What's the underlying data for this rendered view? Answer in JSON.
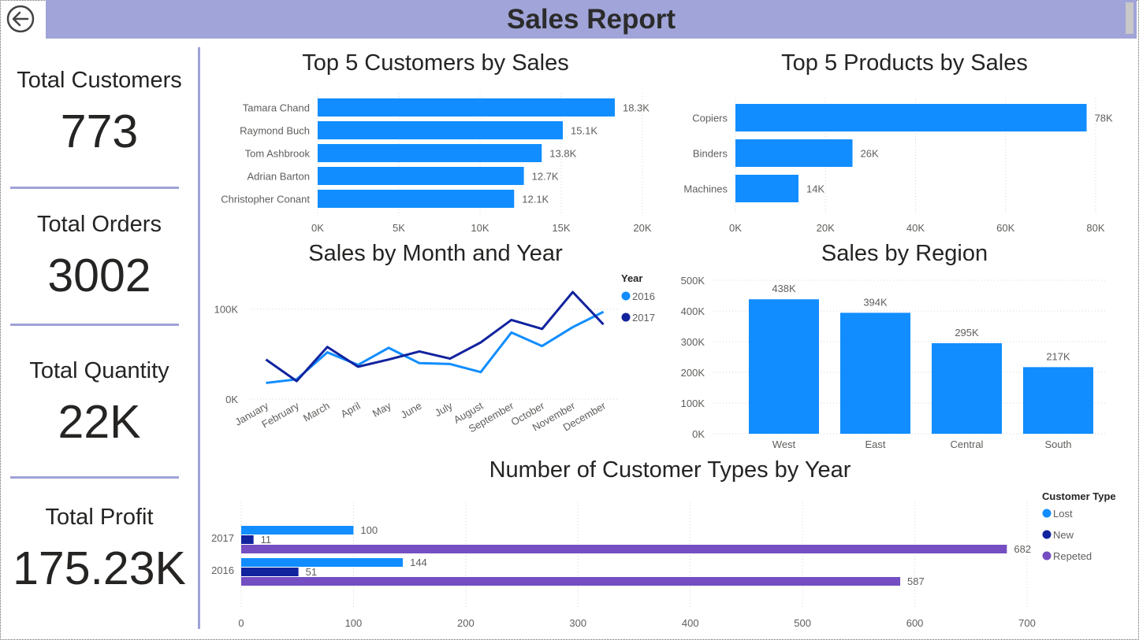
{
  "header": {
    "title": "Sales Report"
  },
  "kpis": [
    {
      "label": "Total Customers",
      "value": "773"
    },
    {
      "label": "Total Orders",
      "value": "3002"
    },
    {
      "label": "Total Quantity",
      "value": "22K"
    },
    {
      "label": "Total Profit",
      "value": "175.23K"
    }
  ],
  "colors": {
    "accent": "#118dff",
    "dark": "#12239e",
    "purple": "#744ec2",
    "header_bg": "#a0a4d8",
    "divider": "#9fa2d6"
  },
  "icons": {
    "back": "back-arrow-circle-icon"
  },
  "chart_data": [
    {
      "id": "customers",
      "type": "bar",
      "orientation": "horizontal",
      "title": "Top 5 Customers by Sales",
      "categories": [
        "Tamara Chand",
        "Raymond Buch",
        "Tom Ashbrook",
        "Adrian Barton",
        "Christopher Conant"
      ],
      "values": [
        18300,
        15100,
        13800,
        12700,
        12100
      ],
      "data_labels": [
        "18.3K",
        "15.1K",
        "13.8K",
        "12.7K",
        "12.1K"
      ],
      "xlim": [
        0,
        20000
      ],
      "ticks": [
        0,
        5000,
        10000,
        15000,
        20000
      ],
      "tick_labels": [
        "0K",
        "5K",
        "10K",
        "15K",
        "20K"
      ],
      "grid": true
    },
    {
      "id": "products",
      "type": "bar",
      "orientation": "horizontal",
      "title": "Top 5 Products by Sales",
      "categories": [
        "Copiers",
        "Binders",
        "Machines"
      ],
      "values": [
        78000,
        26000,
        14000
      ],
      "data_labels": [
        "78K",
        "26K",
        "14K"
      ],
      "xlim": [
        0,
        80000
      ],
      "ticks": [
        0,
        20000,
        40000,
        60000,
        80000
      ],
      "tick_labels": [
        "0K",
        "20K",
        "40K",
        "60K",
        "80K"
      ],
      "grid": true
    },
    {
      "id": "monthly",
      "type": "line",
      "title": "Sales by Month and Year",
      "categories": [
        "January",
        "February",
        "March",
        "April",
        "May",
        "June",
        "July",
        "August",
        "September",
        "October",
        "November",
        "December"
      ],
      "series": [
        {
          "name": "2016",
          "color": "#118dff",
          "values": [
            18000,
            22000,
            52000,
            38000,
            57000,
            40000,
            39000,
            30000,
            74000,
            59000,
            80000,
            97000
          ]
        },
        {
          "name": "2017",
          "color": "#12239e",
          "values": [
            44000,
            20000,
            58000,
            36000,
            44000,
            53000,
            45000,
            63000,
            88000,
            78000,
            119000,
            83000
          ]
        }
      ],
      "legend_title": "Year",
      "legend_position": "top-right",
      "ylim": [
        0,
        140000
      ],
      "yticks": [
        0,
        100000
      ],
      "ytick_labels": [
        "0K",
        "100K"
      ],
      "grid": true
    },
    {
      "id": "region",
      "type": "bar",
      "orientation": "vertical",
      "title": "Sales by Region",
      "categories": [
        "West",
        "East",
        "Central",
        "South"
      ],
      "values": [
        438000,
        394000,
        295000,
        217000
      ],
      "data_labels": [
        "438K",
        "394K",
        "295K",
        "217K"
      ],
      "ylim": [
        0,
        500000
      ],
      "yticks": [
        0,
        100000,
        200000,
        300000,
        400000,
        500000
      ],
      "ytick_labels": [
        "0K",
        "100K",
        "200K",
        "300K",
        "400K",
        "500K"
      ],
      "grid": true
    },
    {
      "id": "custtypes",
      "type": "bar",
      "orientation": "horizontal",
      "grouped": true,
      "title": "Number of Customer Types by Year",
      "categories": [
        "2017",
        "2016"
      ],
      "series": [
        {
          "name": "Lost",
          "color": "#118dff",
          "values": [
            100,
            144
          ]
        },
        {
          "name": "New",
          "color": "#12239e",
          "values": [
            11,
            51
          ]
        },
        {
          "name": "Repeted",
          "color": "#744ec2",
          "values": [
            682,
            587
          ]
        }
      ],
      "legend_title": "Customer Type",
      "legend_position": "right",
      "xlim": [
        0,
        700
      ],
      "ticks": [
        0,
        100,
        200,
        300,
        400,
        500,
        600,
        700
      ],
      "tick_labels": [
        "0",
        "100",
        "200",
        "300",
        "400",
        "500",
        "600",
        "700"
      ],
      "grid": true
    }
  ]
}
